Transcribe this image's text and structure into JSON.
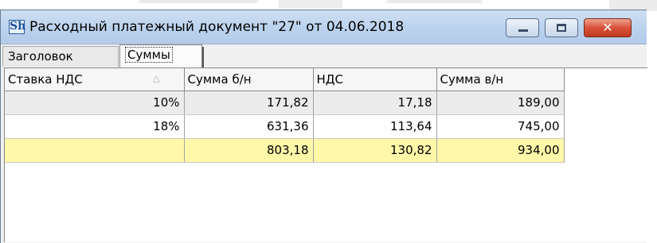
{
  "window": {
    "title": "Расходный платежный документ \"27\" от 04.06.2018",
    "app_icon_text": "Sh",
    "buttons": {
      "minimize": "minimize-icon",
      "maximize": "maximize-icon",
      "close": "close-icon"
    },
    "close_glyph": "✕"
  },
  "tabs": [
    {
      "label": "Заголовок",
      "active": false
    },
    {
      "label": "Суммы",
      "active": true
    }
  ],
  "grid": {
    "columns": [
      "Ставка НДС",
      "Сумма б/н",
      "НДС",
      "Сумма в/н"
    ],
    "sort_indicator": "△",
    "rows": [
      [
        "10%",
        "171,82",
        "17,18",
        "189,00"
      ],
      [
        "18%",
        "631,36",
        "113,64",
        "745,00"
      ]
    ],
    "total": [
      "",
      "803,18",
      "130,82",
      "934,00"
    ]
  },
  "colors": {
    "total_row": "#fff8a8",
    "titlebar": "#bcd3ee",
    "close_button": "#d8513a"
  }
}
